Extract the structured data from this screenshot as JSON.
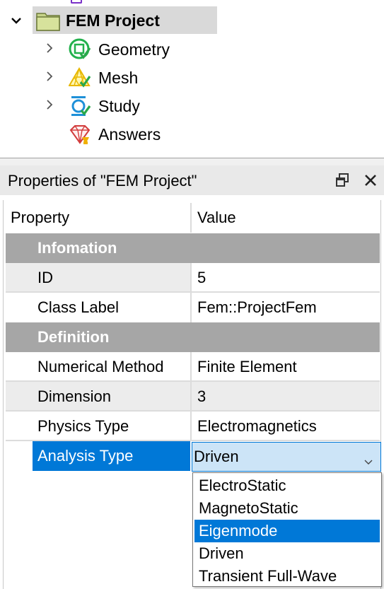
{
  "tree": {
    "root": {
      "label": "FEM Project",
      "icon": "folder-icon"
    },
    "children": [
      {
        "label": "Geometry",
        "icon": "geometry-icon",
        "expandable": true
      },
      {
        "label": "Mesh",
        "icon": "mesh-icon",
        "expandable": true
      },
      {
        "label": "Study",
        "icon": "study-icon",
        "expandable": true
      },
      {
        "label": "Answers",
        "icon": "answers-icon",
        "expandable": false
      }
    ]
  },
  "properties": {
    "title": "Properties of \"FEM Project\"",
    "columns": {
      "property": "Property",
      "value": "Value"
    },
    "groups": [
      {
        "name": "Infomation",
        "rows": [
          {
            "label": "ID",
            "value": "5"
          },
          {
            "label": "Class Label",
            "value": "Fem::ProjectFem"
          }
        ]
      },
      {
        "name": "Definition",
        "rows": [
          {
            "label": "Numerical Method",
            "value": "Finite Element"
          },
          {
            "label": "Dimension",
            "value": "3"
          },
          {
            "label": "Physics Type",
            "value": "Electromagnetics"
          },
          {
            "label": "Analysis Type",
            "value": "Driven"
          }
        ]
      }
    ],
    "dropdown": {
      "selected": "Driven",
      "highlighted": "Eigenmode",
      "options": [
        "ElectroStatic",
        "MagnetoStatic",
        "Eigenmode",
        "Driven",
        "Transient Full-Wave"
      ]
    }
  },
  "colors": {
    "selection": "#0078d7",
    "combo_bg": "#cce4f7",
    "group_header": "#a6a6a6",
    "tree_selection": "#d9d9d9"
  }
}
